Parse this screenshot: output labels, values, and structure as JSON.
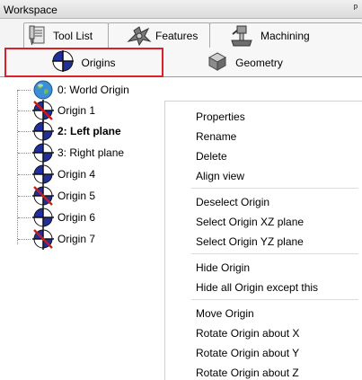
{
  "window": {
    "title": "Workspace",
    "pin_glyph": "ᵖ"
  },
  "tabs_row1": [
    {
      "label": "Tool List",
      "icon": "tool-list-icon"
    },
    {
      "label": "Features",
      "icon": "features-icon"
    },
    {
      "label": "Machining",
      "icon": "machining-icon"
    }
  ],
  "tabs_row2": [
    {
      "label": "Origins",
      "icon": "origin-icon",
      "active": true
    },
    {
      "label": "Geometry",
      "icon": "geometry-icon",
      "active": false
    }
  ],
  "tree": {
    "items": [
      {
        "label": "0: World Origin",
        "icon": "globe-icon",
        "bold": false
      },
      {
        "label": "Origin 1",
        "icon": "origin-crossed-icon",
        "bold": false
      },
      {
        "label": "2:  Left plane",
        "icon": "origin-icon",
        "bold": true
      },
      {
        "label": "3: Right plane",
        "icon": "origin-icon",
        "bold": false
      },
      {
        "label": "Origin 4",
        "icon": "origin-icon",
        "bold": false
      },
      {
        "label": "Origin 5",
        "icon": "origin-crossed-icon",
        "bold": false
      },
      {
        "label": "Origin 6",
        "icon": "origin-icon",
        "bold": false
      },
      {
        "label": "Origin 7",
        "icon": "origin-crossed-icon",
        "bold": false
      }
    ]
  },
  "context_menu": {
    "groups": [
      [
        "Properties",
        "Rename",
        "Delete",
        "Align view"
      ],
      [
        "Deselect Origin",
        "Select Origin XZ plane",
        "Select Origin YZ plane"
      ],
      [
        "Hide Origin",
        "Hide all Origin except this"
      ],
      [
        "Move Origin",
        "Rotate Origin about X",
        "Rotate Origin about Y",
        "Rotate Origin about Z"
      ]
    ]
  },
  "colors": {
    "highlight_border": "#d9212a",
    "origin_blue": "#1f2f9e",
    "cross_red": "#d01818"
  }
}
